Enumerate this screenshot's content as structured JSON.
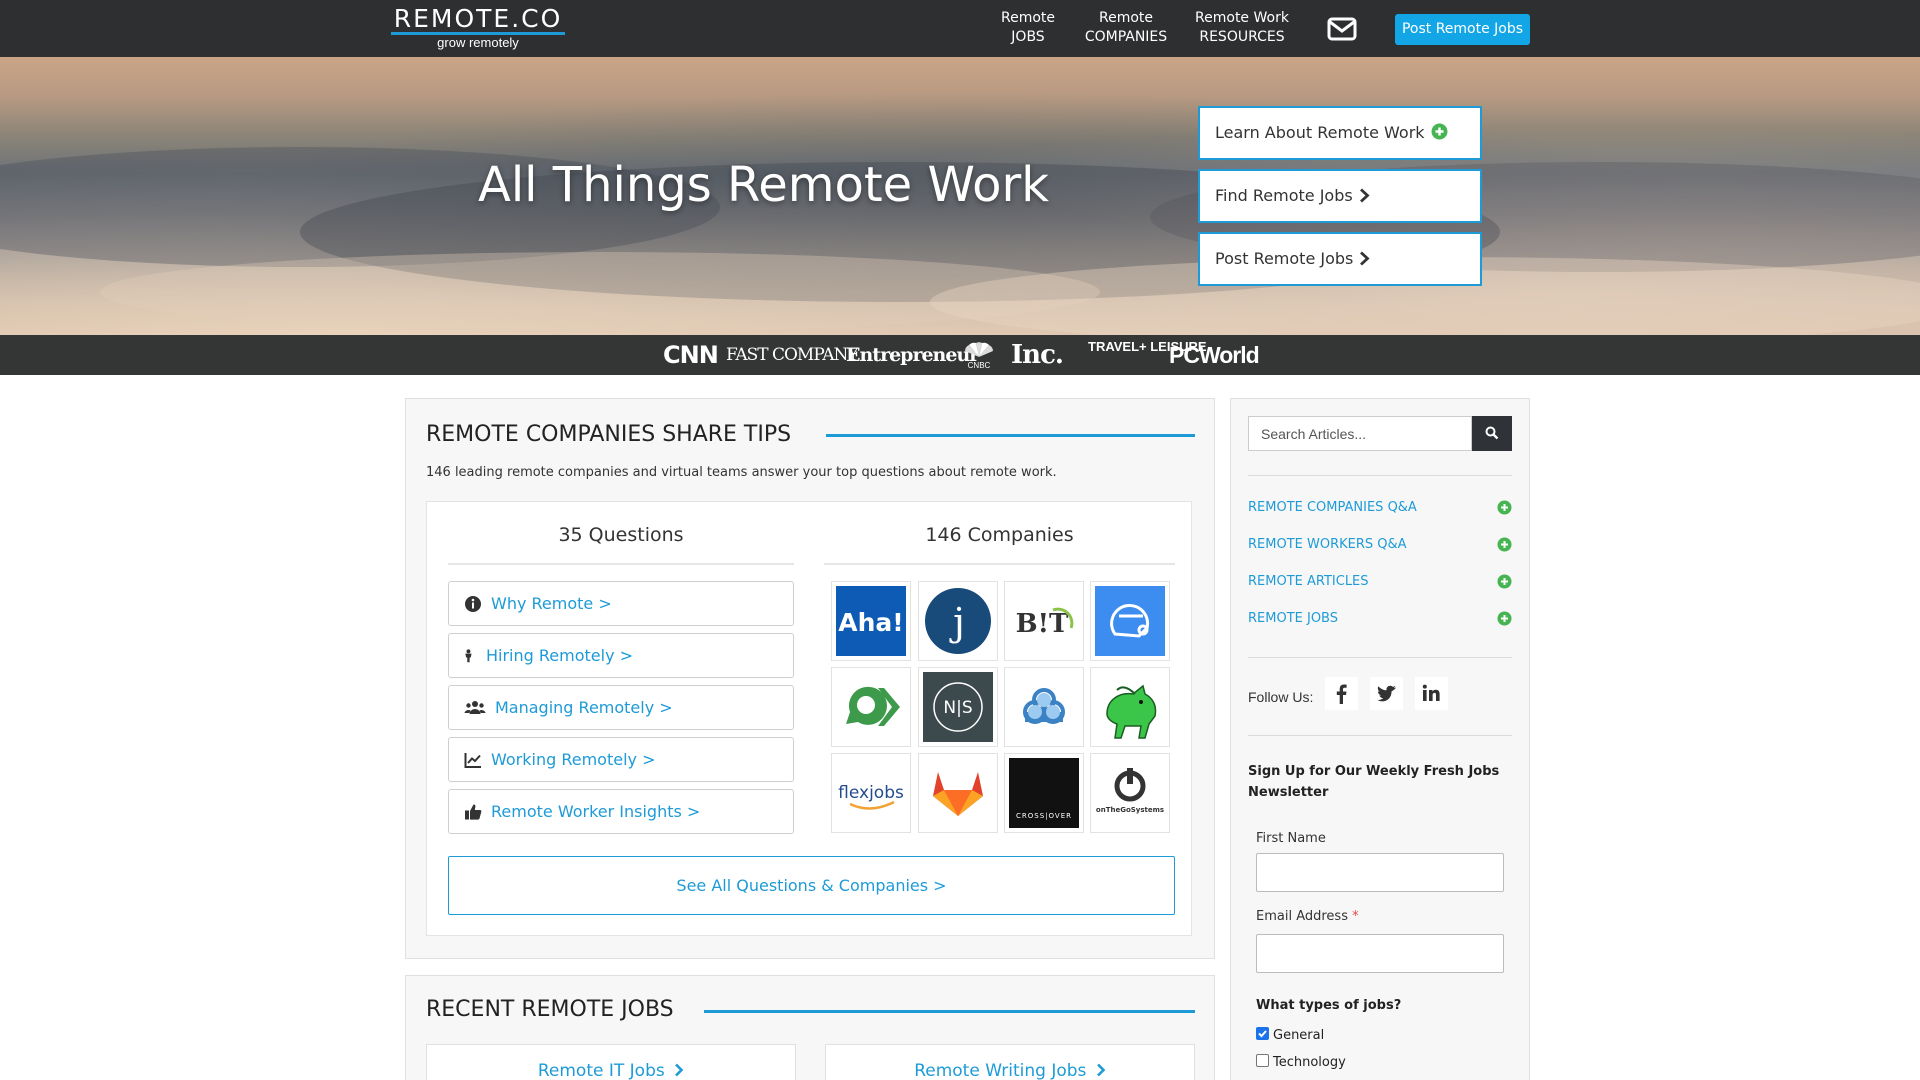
{
  "nav": {
    "logo": "REMOTE.CO",
    "tagline": "grow remotely",
    "links": [
      {
        "line1": "Remote",
        "line2": "JOBS"
      },
      {
        "line1": "Remote",
        "line2": "COMPANIES"
      },
      {
        "line1": "Remote Work",
        "line2": "RESOURCES"
      }
    ],
    "mail_icon": "envelope-icon",
    "post_button": "Post Remote Jobs"
  },
  "hero": {
    "title": "All Things Remote Work",
    "buttons": [
      {
        "label": "Learn About Remote Work",
        "icon": "plus-circle-icon"
      },
      {
        "label": "Find Remote Jobs",
        "icon": "chevron-right-icon"
      },
      {
        "label": "Post Remote Jobs",
        "icon": "chevron-right-icon"
      }
    ]
  },
  "press": [
    "CNN",
    "FAST COMPANY",
    "Entrepreneur",
    "CNBC",
    "Inc.",
    "TRAVEL+ LEISURE",
    "PCWorld"
  ],
  "tips": {
    "title": "REMOTE COMPANIES SHARE TIPS",
    "lead": "146 leading remote companies and virtual teams answer your top questions about remote work.",
    "questions_heading": "35 Questions",
    "companies_heading": "146 Companies",
    "questions": [
      {
        "label": "Why Remote >",
        "icon": "info-circle-icon"
      },
      {
        "label": "Hiring Remotely >",
        "icon": "person-icon"
      },
      {
        "label": "Managing Remotely >",
        "icon": "users-icon"
      },
      {
        "label": "Working Remotely >",
        "icon": "line-chart-icon"
      },
      {
        "label": "Remote Worker Insights >",
        "icon": "thumbs-up-icon"
      }
    ],
    "company_logos": [
      "Aha!",
      "j",
      "B!T",
      "",
      "",
      "N|S",
      "",
      "",
      "flexjobs",
      "",
      "CROSS|OVER",
      "onTheGoSystems"
    ],
    "see_all": "See All Questions & Companies >"
  },
  "recent_jobs": {
    "title": "RECENT REMOTE JOBS",
    "cards": [
      "Remote IT Jobs",
      "Remote Writing Jobs"
    ]
  },
  "sidebar": {
    "search_placeholder": "Search Articles...",
    "links": [
      "REMOTE COMPANIES Q&A",
      "REMOTE WORKERS Q&A",
      "REMOTE ARTICLES",
      "REMOTE JOBS"
    ],
    "follow_label": "Follow Us:",
    "newsletter_title": "Sign Up for Our Weekly Fresh Jobs Newsletter",
    "first_name_label": "First Name",
    "email_label": "Email Address",
    "required_mark": "*",
    "types_label": "What types of jobs?",
    "checkboxes": [
      {
        "label": "General",
        "checked": true
      },
      {
        "label": "Technology",
        "checked": false
      }
    ]
  },
  "colors": {
    "accent": "#1e9bd7",
    "nav_bg": "#2d2f31",
    "post_button": "#13a6e6",
    "plus_green": "#46b450"
  }
}
